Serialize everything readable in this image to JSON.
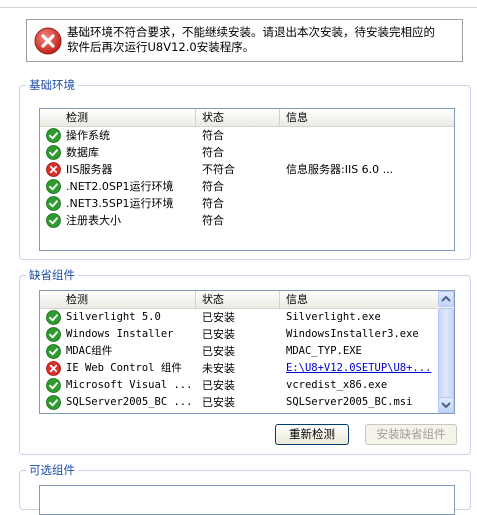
{
  "banner": {
    "line1": "基础环境不符合要求，不能继续安装。请退出本次安装，待安装完相应的",
    "line2": "软件后再次运行U8V12.0安装程序。"
  },
  "basic_env": {
    "title": "基础环境",
    "columns": [
      "检测",
      "状态",
      "信息"
    ],
    "rows": [
      {
        "status_icon": "check-icon",
        "name": "操作系统",
        "state": "符合",
        "info": ""
      },
      {
        "status_icon": "check-icon",
        "name": "数据库",
        "state": "符合",
        "info": ""
      },
      {
        "status_icon": "error-icon",
        "name": "IIS服务器",
        "state": "不符合",
        "info": "信息服务器:IIS 6.0 ..."
      },
      {
        "status_icon": "check-icon",
        "name": ".NET2.0SP1运行环境",
        "state": "符合",
        "info": ""
      },
      {
        "status_icon": "check-icon",
        "name": ".NET3.5SP1运行环境",
        "state": "符合",
        "info": ""
      },
      {
        "status_icon": "check-icon",
        "name": "注册表大小",
        "state": "符合",
        "info": ""
      }
    ]
  },
  "default_components": {
    "title": "缺省组件",
    "columns": [
      "检测",
      "状态",
      "信息"
    ],
    "rows": [
      {
        "status_icon": "check-icon",
        "name": "Silverlight 5.0",
        "state": "已安装",
        "info": "Silverlight.exe",
        "info_link": false
      },
      {
        "status_icon": "check-icon",
        "name": "Windows Installer",
        "state": "已安装",
        "info": "WindowsInstaller3.exe",
        "info_link": false
      },
      {
        "status_icon": "check-icon",
        "name": "MDAC组件",
        "state": "已安装",
        "info": "MDAC_TYP.EXE",
        "info_link": false
      },
      {
        "status_icon": "error-icon",
        "name": "IE Web Control 组件",
        "state": "未安装",
        "info": "E:\\U8+V12.0SETUP\\U8+...",
        "info_link": true
      },
      {
        "status_icon": "check-icon",
        "name": "Microsoft Visual ...",
        "state": "已安装",
        "info": "vcredist_x86.exe",
        "info_link": false
      },
      {
        "status_icon": "check-icon",
        "name": "SQLServer2005_BC ...",
        "state": "已安装",
        "info": "SQLServer2005_BC.msi",
        "info_link": false
      }
    ],
    "recheck_label": "重新检测",
    "install_label": "安装缺省组件"
  },
  "optional_components": {
    "title": "可选组件"
  },
  "colors": {
    "accent_blue": "#1f4ea8",
    "error_red": "#d9302c",
    "ok_green": "#2e9b2e"
  }
}
